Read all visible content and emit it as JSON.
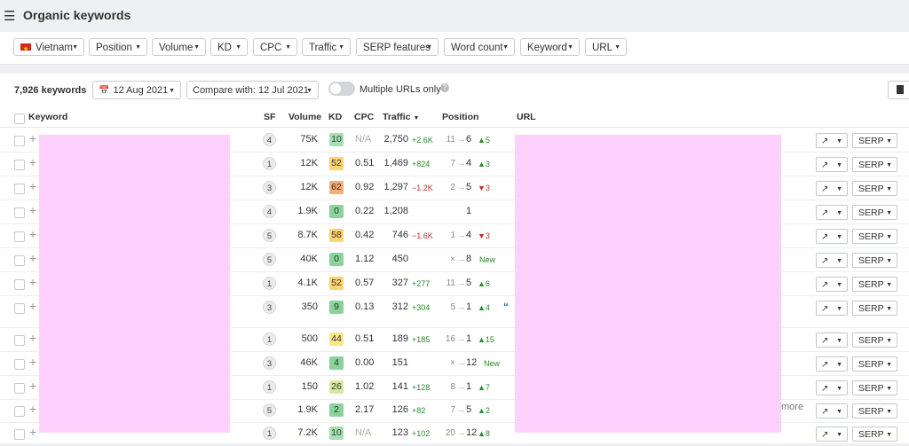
{
  "header": {
    "title": "Organic keywords",
    "menu_icon": "hamburger-icon"
  },
  "filters": [
    {
      "label": "Vietnam",
      "flag": "vietnam-flag-icon"
    },
    {
      "label": "Position"
    },
    {
      "label": "Volume"
    },
    {
      "label": "KD"
    },
    {
      "label": "CPC"
    },
    {
      "label": "Traffic"
    },
    {
      "label": "SERP features"
    },
    {
      "label": "Word count"
    },
    {
      "label": "Keyword"
    },
    {
      "label": "URL"
    }
  ],
  "toolbar": {
    "keyword_count": "7,926 keywords",
    "date": "12 Aug 2021",
    "compare": "Compare with: 12 Jul 2021",
    "multiple_urls_label": "Multiple URLs only",
    "multiple_urls_on": false
  },
  "table": {
    "headers": {
      "keyword": "Keyword",
      "sf": "SF",
      "volume": "Volume",
      "kd": "KD",
      "cpc": "CPC",
      "traffic": "Traffic",
      "position": "Position",
      "url": "URL"
    },
    "sort_column": "traffic",
    "rows": [
      {
        "sf": "4",
        "volume": "75K",
        "kd": "10",
        "kd_color": "#a5e0b2",
        "cpc": "N/A",
        "traffic": "2,750",
        "traffic_change": "+2.6K",
        "traffic_dir": "up",
        "pos_from": "11",
        "pos_to": "6",
        "pos_change": "5",
        "pos_dir": "up"
      },
      {
        "sf": "1",
        "volume": "12K",
        "kd": "52",
        "kd_color": "#fcd56f",
        "cpc": "0.51",
        "traffic": "1,469",
        "traffic_change": "+824",
        "traffic_dir": "up",
        "pos_from": "7",
        "pos_to": "4",
        "pos_change": "3",
        "pos_dir": "up"
      },
      {
        "sf": "3",
        "volume": "12K",
        "kd": "62",
        "kd_color": "#f9ad70",
        "cpc": "0.92",
        "traffic": "1,297",
        "traffic_change": "−1.2K",
        "traffic_dir": "down",
        "pos_from": "2",
        "pos_to": "5",
        "pos_change": "3",
        "pos_dir": "down"
      },
      {
        "sf": "4",
        "volume": "1.9K",
        "kd": "0",
        "kd_color": "#8bd39a",
        "cpc": "0.22",
        "traffic": "1,208",
        "traffic_change": "",
        "traffic_dir": "",
        "pos_from": "",
        "pos_to": "1",
        "pos_change": "",
        "pos_dir": ""
      },
      {
        "sf": "5",
        "volume": "8.7K",
        "kd": "58",
        "kd_color": "#fcd56f",
        "cpc": "0.42",
        "traffic": "746",
        "traffic_change": "−1.6K",
        "traffic_dir": "down",
        "pos_from": "1",
        "pos_to": "4",
        "pos_change": "3",
        "pos_dir": "down"
      },
      {
        "sf": "5",
        "volume": "40K",
        "kd": "0",
        "kd_color": "#8bd39a",
        "cpc": "1.12",
        "traffic": "450",
        "traffic_change": "",
        "traffic_dir": "",
        "pos_from": "×",
        "pos_to": "8",
        "pos_change": "New",
        "pos_dir": "new"
      },
      {
        "sf": "1",
        "volume": "4.1K",
        "kd": "52",
        "kd_color": "#fcd56f",
        "cpc": "0.57",
        "traffic": "327",
        "traffic_change": "+277",
        "traffic_dir": "up",
        "pos_from": "11",
        "pos_to": "5",
        "pos_change": "6",
        "pos_dir": "up"
      },
      {
        "sf": "3",
        "volume": "350",
        "kd": "9",
        "kd_color": "#8bd39a",
        "cpc": "0.13",
        "traffic": "312",
        "traffic_change": "+304",
        "traffic_dir": "up",
        "pos_from": "5",
        "pos_to": "1",
        "pos_change": "4",
        "pos_dir": "up"
      },
      {
        "sf": "1",
        "volume": "500",
        "kd": "44",
        "kd_color": "#fce68a",
        "cpc": "0.51",
        "traffic": "189",
        "traffic_change": "+185",
        "traffic_dir": "up",
        "pos_from": "16",
        "pos_to": "1",
        "pos_change": "15",
        "pos_dir": "up"
      },
      {
        "sf": "3",
        "volume": "46K",
        "kd": "4",
        "kd_color": "#8bd39a",
        "cpc": "0.00",
        "traffic": "151",
        "traffic_change": "",
        "traffic_dir": "",
        "pos_from": "×",
        "pos_to": "12",
        "pos_change": "New",
        "pos_dir": "new"
      },
      {
        "sf": "1",
        "volume": "150",
        "kd": "26",
        "kd_color": "#d7e8a0",
        "cpc": "1.02",
        "traffic": "141",
        "traffic_change": "+128",
        "traffic_dir": "up",
        "pos_from": "8",
        "pos_to": "1",
        "pos_change": "7",
        "pos_dir": "up"
      },
      {
        "sf": "5",
        "volume": "1.9K",
        "kd": "2",
        "kd_color": "#8bd39a",
        "cpc": "2.17",
        "traffic": "126",
        "traffic_change": "+82",
        "traffic_dir": "up",
        "pos_from": "7",
        "pos_to": "5",
        "pos_change": "2",
        "pos_dir": "up"
      },
      {
        "sf": "1",
        "volume": "7.2K",
        "kd": "10",
        "kd_color": "#a5e0b2",
        "cpc": "N/A",
        "traffic": "123",
        "traffic_change": "+102",
        "traffic_dir": "up",
        "pos_from": "20",
        "pos_to": "12",
        "pos_change": "8",
        "pos_dir": "up"
      }
    ],
    "chart_button_icon": "trend-chart-icon",
    "serp_label": "SERP",
    "more_text": "more"
  },
  "colors": {
    "up": "#2a8a2a",
    "down": "#c23030",
    "redacted_mask": "#fdd0fd"
  }
}
